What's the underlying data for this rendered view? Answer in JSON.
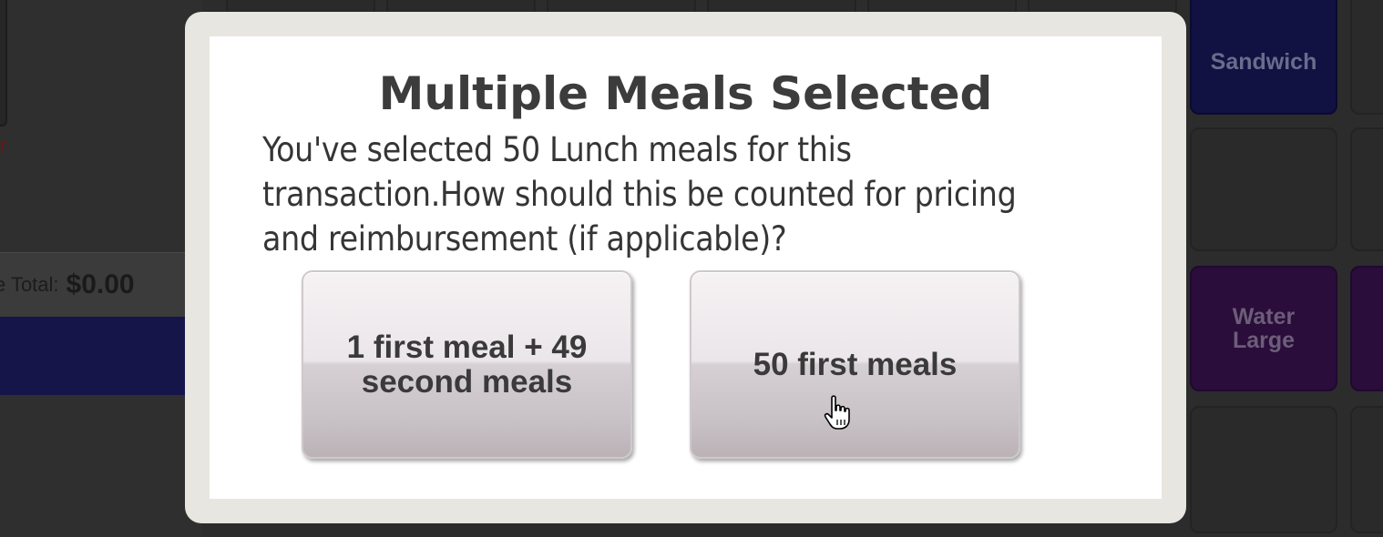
{
  "background": {
    "total_label": "e Total:",
    "total_value": "$0.00",
    "tiles": {
      "sandwich": "Sandwich",
      "water_large_line1": "Water",
      "water_large_line2": "Large"
    }
  },
  "dialog": {
    "title": "Multiple Meals Selected",
    "message": "You've selected 50 Lunch meals for this transaction.How should this be counted for pricing and reimbursement (if applicable)?",
    "option_1": "1 first meal + 49 second meals",
    "option_2": "50 first meals"
  },
  "icons": {
    "cursor": "hand-pointer-icon"
  },
  "colors": {
    "modal_frame": "#e7e6e1",
    "modal_body": "#ffffff",
    "tile_navy": "#111142",
    "tile_purple": "#2a0d3a"
  }
}
